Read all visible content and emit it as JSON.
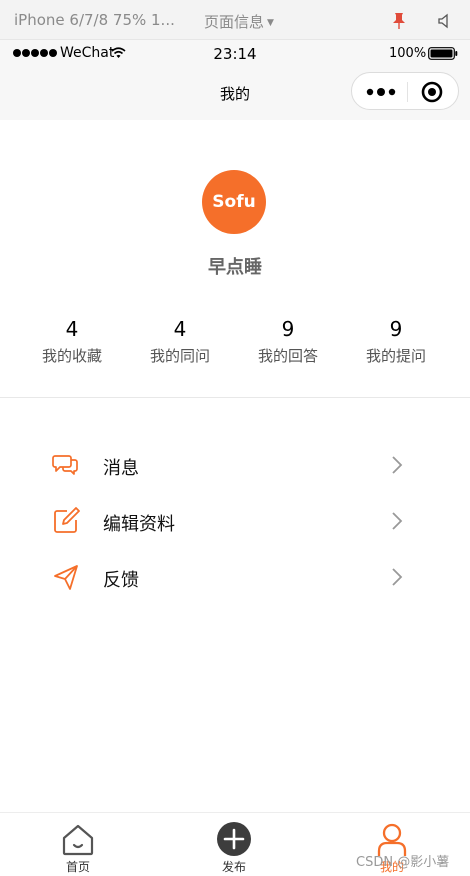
{
  "simulator": {
    "device": "iPhone 6/7/8 75% 1...",
    "page_info": "页面信息"
  },
  "status_bar": {
    "carrier": "WeChat",
    "time": "23:14",
    "battery": "100%"
  },
  "nav": {
    "title": "我的"
  },
  "profile": {
    "avatar_text": "Sofu",
    "avatar_color": "#f56f2a",
    "nickname": "早点睡"
  },
  "stats": [
    {
      "value": "4",
      "label": "我的收藏"
    },
    {
      "value": "4",
      "label": "我的同问"
    },
    {
      "value": "9",
      "label": "我的回答"
    },
    {
      "value": "9",
      "label": "我的提问"
    }
  ],
  "menu": [
    {
      "label": "消息",
      "icon": "message-icon"
    },
    {
      "label": "编辑资料",
      "icon": "edit-icon"
    },
    {
      "label": "反馈",
      "icon": "send-icon"
    }
  ],
  "tabs": [
    {
      "label": "首页",
      "icon": "home-icon",
      "active": false
    },
    {
      "label": "发布",
      "icon": "add-icon",
      "active": false
    },
    {
      "label": "我的",
      "icon": "user-icon",
      "active": true
    }
  ],
  "watermark": "CSDN @影小薯",
  "accent_color": "#f56f2a"
}
